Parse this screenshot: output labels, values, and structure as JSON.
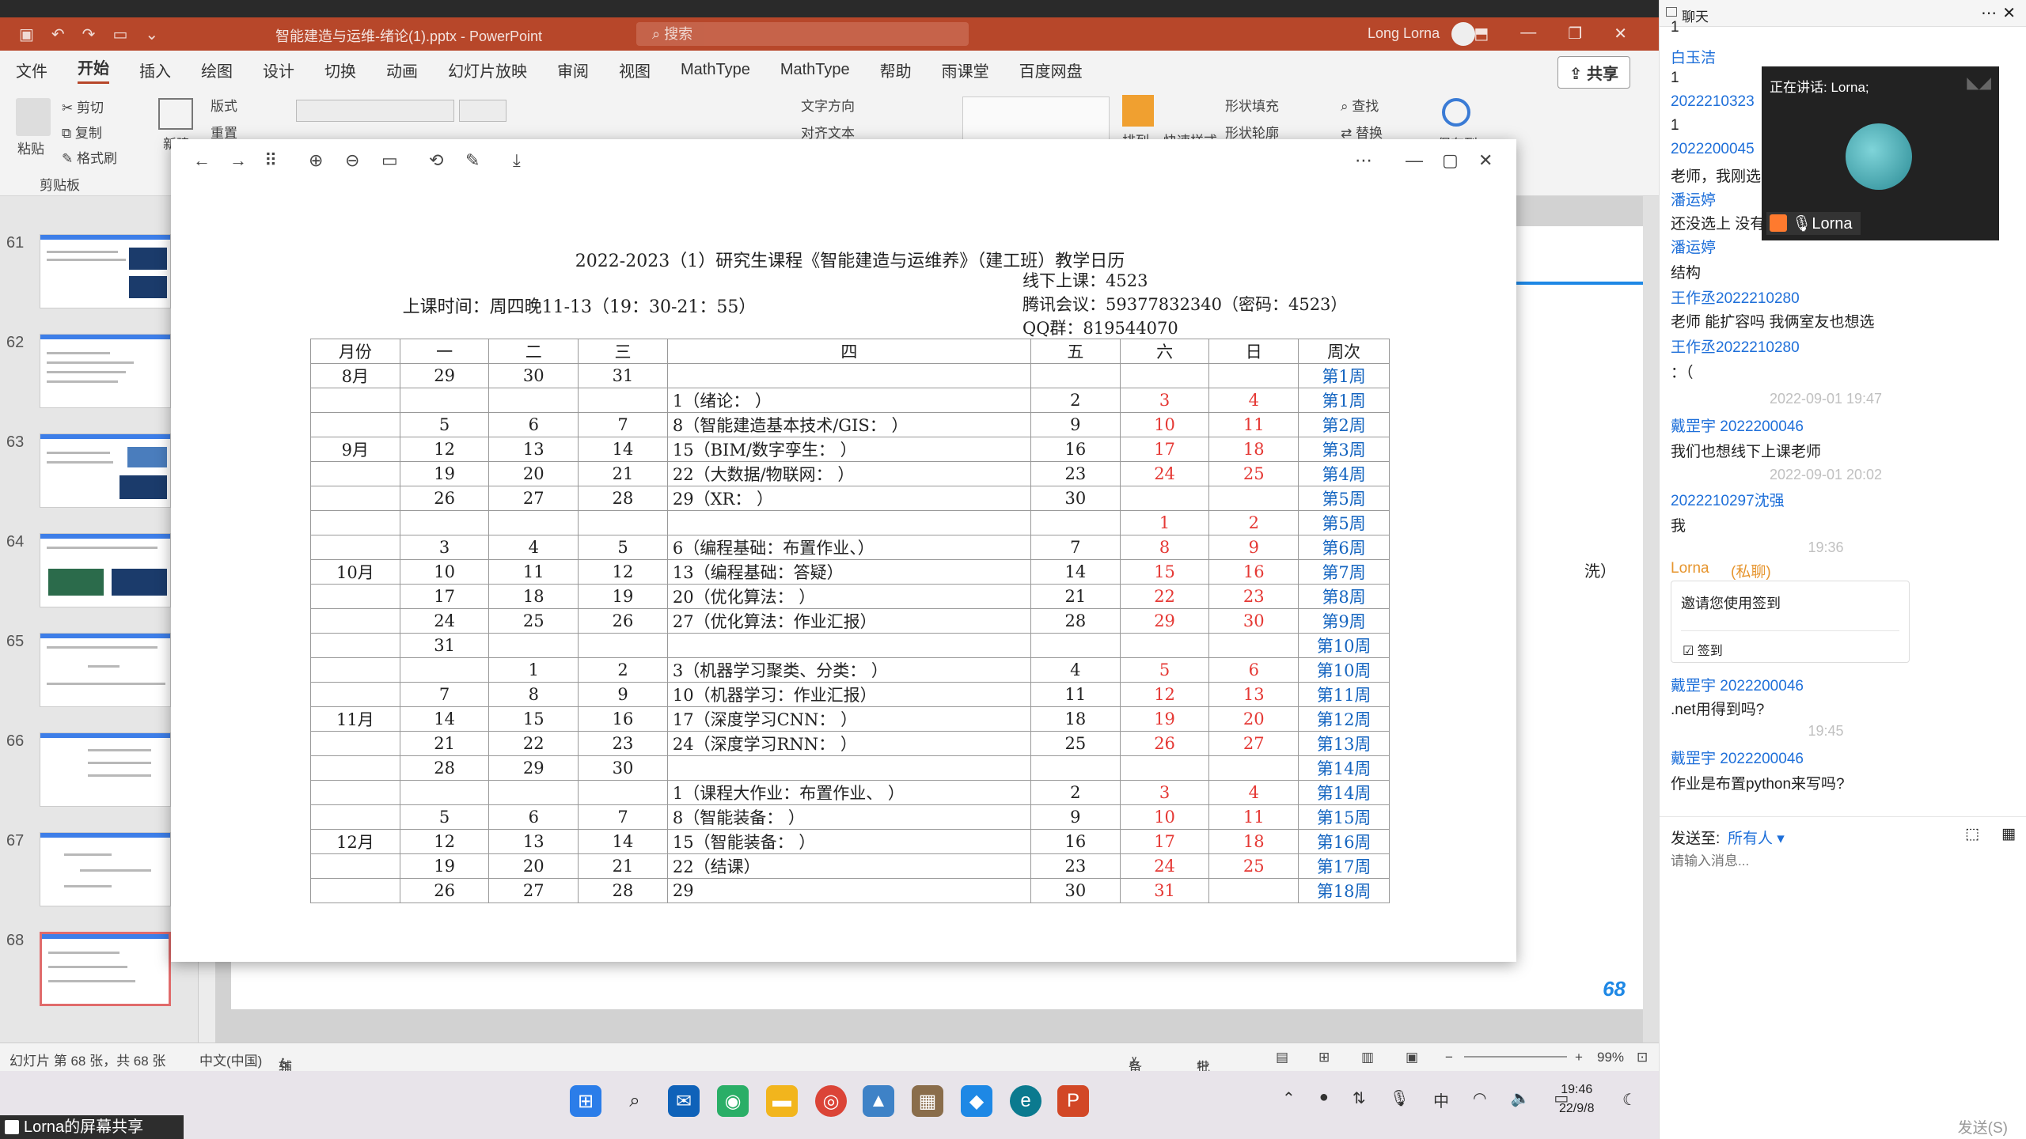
{
  "powerpoint": {
    "doc_title": "智能建造与运维-绪论(1).pptx - PowerPoint",
    "search_placeholder": "搜索",
    "user_name": "Long Lorna",
    "menu_tabs": [
      "文件",
      "开始",
      "插入",
      "绘图",
      "设计",
      "切换",
      "动画",
      "幻灯片放映",
      "审阅",
      "视图",
      "MathType",
      "MathType",
      "帮助",
      "雨课堂",
      "百度网盘"
    ],
    "share_label": "共享",
    "ribbon": {
      "paste": "粘贴",
      "cut": "剪切",
      "copy": "复制",
      "format_painter": "格式刷",
      "clipboard": "剪贴板",
      "layout": "版式",
      "reset": "重置",
      "new_slide": "新建",
      "text_direction": "文字方向",
      "align_text": "对齐文本",
      "shape_fill": "形状填充",
      "shape_outline": "形状轮廓",
      "find": "查找",
      "replace": "替换",
      "arrange": "排列",
      "quick_styles": "快速样式",
      "save_to": "保存到"
    },
    "thumbnail_numbers": [
      "61",
      "62",
      "63",
      "64",
      "65",
      "66",
      "67",
      "68"
    ],
    "slide_page_number": "68",
    "slide_fragment": "洗）",
    "status": {
      "slide_count": "幻灯片 第 68 张，共 68 张",
      "language": "中文(中国)",
      "accessibility": "辅助功能: 调查",
      "notes": "备注",
      "comments": "批注",
      "zoom": "99%"
    }
  },
  "viewer": {
    "calendar": {
      "title": "2022-2023（1）研究生课程《智能建造与运维养》（建工班）教学日历",
      "class_time": "上课时间：周四晚11-13（19：30-21：55）",
      "offline": "线下上课：4523",
      "tencent": "腾讯会议：59377832340（密码：4523）",
      "qq": "QQ群：819544070",
      "headers": [
        "月份",
        "一",
        "二",
        "三",
        "四",
        "五",
        "六",
        "日",
        "周次"
      ],
      "rows": [
        [
          "8月",
          "29",
          "30",
          "31",
          "",
          "",
          "",
          "",
          "第1周"
        ],
        [
          "",
          "",
          "",
          "",
          "1（绪论：  ）",
          "2",
          "3",
          "4",
          "第1周"
        ],
        [
          "",
          "5",
          "6",
          "7",
          "8（智能建造基本技术/GIS：  ）",
          "9",
          "10",
          "11",
          "第2周"
        ],
        [
          "9月",
          "12",
          "13",
          "14",
          "15（BIM/数字孪生：  ）",
          "16",
          "17",
          "18",
          "第3周"
        ],
        [
          "",
          "19",
          "20",
          "21",
          "22（大数据/物联网：  ）",
          "23",
          "24",
          "25",
          "第4周"
        ],
        [
          "",
          "26",
          "27",
          "28",
          "29（XR：  ）",
          "30",
          "",
          "",
          "第5周"
        ],
        [
          "",
          "",
          "",
          "",
          "",
          "",
          "1",
          "2",
          "第5周"
        ],
        [
          "",
          "3",
          "4",
          "5",
          "6（编程基础：布置作业、）",
          "7",
          "8",
          "9",
          "第6周"
        ],
        [
          "10月",
          "10",
          "11",
          "12",
          "13（编程基础：答疑）",
          "14",
          "15",
          "16",
          "第7周"
        ],
        [
          "",
          "17",
          "18",
          "19",
          "20（优化算法：  ）",
          "21",
          "22",
          "23",
          "第8周"
        ],
        [
          "",
          "24",
          "25",
          "26",
          "27（优化算法：作业汇报）",
          "28",
          "29",
          "30",
          "第9周"
        ],
        [
          "",
          "31",
          "",
          "",
          "",
          "",
          "",
          "",
          "第10周"
        ],
        [
          "",
          "",
          "1",
          "2",
          "3（机器学习聚类、分类：  ）",
          "4",
          "5",
          "6",
          "第10周"
        ],
        [
          "",
          "7",
          "8",
          "9",
          "10（机器学习：作业汇报）",
          "11",
          "12",
          "13",
          "第11周"
        ],
        [
          "11月",
          "14",
          "15",
          "16",
          "17（深度学习CNN：  ）",
          "18",
          "19",
          "20",
          "第12周"
        ],
        [
          "",
          "21",
          "22",
          "23",
          "24（深度学习RNN：  ）",
          "25",
          "26",
          "27",
          "第13周"
        ],
        [
          "",
          "28",
          "29",
          "30",
          "",
          "",
          "",
          "",
          "第14周"
        ],
        [
          "",
          "",
          "",
          "",
          "1（课程大作业：布置作业、  ）",
          "2",
          "3",
          "4",
          "第14周"
        ],
        [
          "",
          "5",
          "6",
          "7",
          "8（智能装备：  ）",
          "9",
          "10",
          "11",
          "第15周"
        ],
        [
          "12月",
          "12",
          "13",
          "14",
          "15（智能装备：  ）",
          "16",
          "17",
          "18",
          "第16周"
        ],
        [
          "",
          "19",
          "20",
          "21",
          "22（结课）",
          "23",
          "24",
          "25",
          "第17周"
        ],
        [
          "",
          "26",
          "27",
          "28",
          "29",
          "30",
          "31",
          "",
          "第18周"
        ]
      ]
    }
  },
  "taskbar": {
    "time": "19:46",
    "date": "22/9/8",
    "ime": "中",
    "share_label": "Lorna的屏幕共享"
  },
  "chat": {
    "title": "聊天",
    "video": {
      "speaking": "正在讲话: Lorna;",
      "name": "Lorna"
    },
    "messages": [
      {
        "type": "text",
        "text": "1"
      },
      {
        "type": "name",
        "text": "白玉洁"
      },
      {
        "type": "text",
        "text": "1"
      },
      {
        "type": "name",
        "text": "2022210323"
      },
      {
        "type": "text",
        "text": "1"
      },
      {
        "type": "name",
        "text": "2022200045"
      },
      {
        "type": "text",
        "text": "老师，我刚选"
      },
      {
        "type": "name",
        "text": "潘运婷"
      },
      {
        "type": "text",
        "text": "还没选上 没有"
      },
      {
        "type": "name",
        "text": "潘运婷"
      },
      {
        "type": "text",
        "text": "结构"
      },
      {
        "type": "name",
        "text": "王作丞2022210280"
      },
      {
        "type": "text",
        "text": "老师 能扩容吗 我俩室友也想选"
      },
      {
        "type": "name",
        "text": "王作丞2022210280"
      },
      {
        "type": "text",
        "text": "：（"
      },
      {
        "type": "time",
        "text": "2022-09-01 19:47"
      },
      {
        "type": "name",
        "text": "戴罡宇 2022200046"
      },
      {
        "type": "text",
        "text": "我们也想线下上课老师"
      },
      {
        "type": "time",
        "text": "2022-09-01 20:02"
      },
      {
        "type": "name",
        "text": "2022210297沈强"
      },
      {
        "type": "text",
        "text": "我"
      },
      {
        "type": "time",
        "text": "19:36"
      },
      {
        "type": "name",
        "text": "Lorna"
      },
      {
        "type": "private",
        "text": "(私聊)"
      },
      {
        "type": "name",
        "text": "戴罡宇 2022200046"
      },
      {
        "type": "text",
        "text": ".net用得到吗?"
      },
      {
        "type": "time",
        "text": "19:45"
      },
      {
        "type": "name",
        "text": "戴罡宇 2022200046"
      },
      {
        "type": "text",
        "text": "作业是布置python来写吗?"
      }
    ],
    "signin_card": {
      "text": "邀请您使用签到",
      "action": "签到"
    },
    "send_to_label": "发送至:",
    "send_to_value": "所有人",
    "input_placeholder": "请输入消息...",
    "send_button": "发送(S)"
  }
}
